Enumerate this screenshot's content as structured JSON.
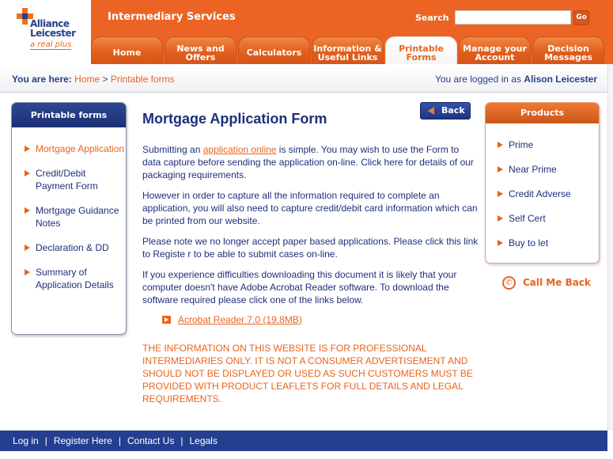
{
  "brand": {
    "name_line1": "Alliance",
    "name_line2": "Leicester",
    "tagline": "a real plus",
    "colors": {
      "orange": "#ec6424",
      "navy": "#1f2f7a",
      "footer": "#243f8f"
    }
  },
  "header": {
    "site_title": "Intermediary Services",
    "search_label": "Search",
    "search_value": "",
    "search_placeholder": "",
    "go_label": "Go"
  },
  "tabs": [
    {
      "label": "Home",
      "active": false
    },
    {
      "label": "News and Offers",
      "active": false
    },
    {
      "label": "Calculators",
      "active": false
    },
    {
      "label": "Information & Useful Links",
      "active": false
    },
    {
      "label": "Printable Forms",
      "active": true
    },
    {
      "label": "Manage your Account",
      "active": false
    },
    {
      "label": "Decision Messages",
      "active": false
    }
  ],
  "breadcrumb": {
    "label": "You are here:",
    "items": [
      "Home",
      "Printable forms"
    ],
    "separator": ">"
  },
  "login_status": {
    "prefix": "You are logged in as",
    "user": "Alison Leicester"
  },
  "left_sidebar": {
    "title": "Printable forms",
    "items": [
      {
        "label": "Mortgage Application",
        "active": true
      },
      {
        "label": "Credit/Debit Payment Form",
        "active": false
      },
      {
        "label": "Mortgage Guidance Notes",
        "active": false
      },
      {
        "label": "Declaration & DD",
        "active": false
      },
      {
        "label": "Summary of Application Details",
        "active": false
      }
    ]
  },
  "main": {
    "title": "Mortgage Application Form",
    "back_label": "Back",
    "para1_before": "Submitting an ",
    "para1_link": "application online",
    "para1_after": " is simple. You may wish to use the Form to data capture before sending the application on-line. Click here for details of our packaging requirements.",
    "para2": "However in order to capture all the information required to complete an application, you will also need to capture credit/debit card information which can be printed from our website.",
    "para3": "Please note we no longer accept paper based applications. Please click this link to Registe r to be able to submit cases on-line.",
    "para4": "If you experience difficulties downloading this document it is likely that your computer doesn't have Adobe Acrobat Reader software. To download the software required please click one of the links below.",
    "download_link": "Acrobat Reader 7.0 (19.8MB)",
    "disclaimer": "THE INFORMATION ON THIS WEBSITE IS FOR PROFESSIONAL INTERMEDIARIES ONLY. IT IS NOT A CONSUMER ADVERTISEMENT AND SHOULD NOT BE DISPLAYED OR USED AS SUCH CUSTOMERS MUST BE PROVIDED WITH PRODUCT LEAFLETS FOR FULL DETAILS AND LEGAL REQUIREMENTS."
  },
  "right_sidebar": {
    "title": "Products",
    "items": [
      "Prime",
      "Near Prime",
      "Credit Adverse",
      "Self Cert",
      "Buy to let"
    ],
    "call_me_back": "Call Me Back"
  },
  "footer": {
    "links": [
      "Log in",
      "Register Here",
      "Contact Us",
      "Legals"
    ],
    "separator": "|"
  }
}
